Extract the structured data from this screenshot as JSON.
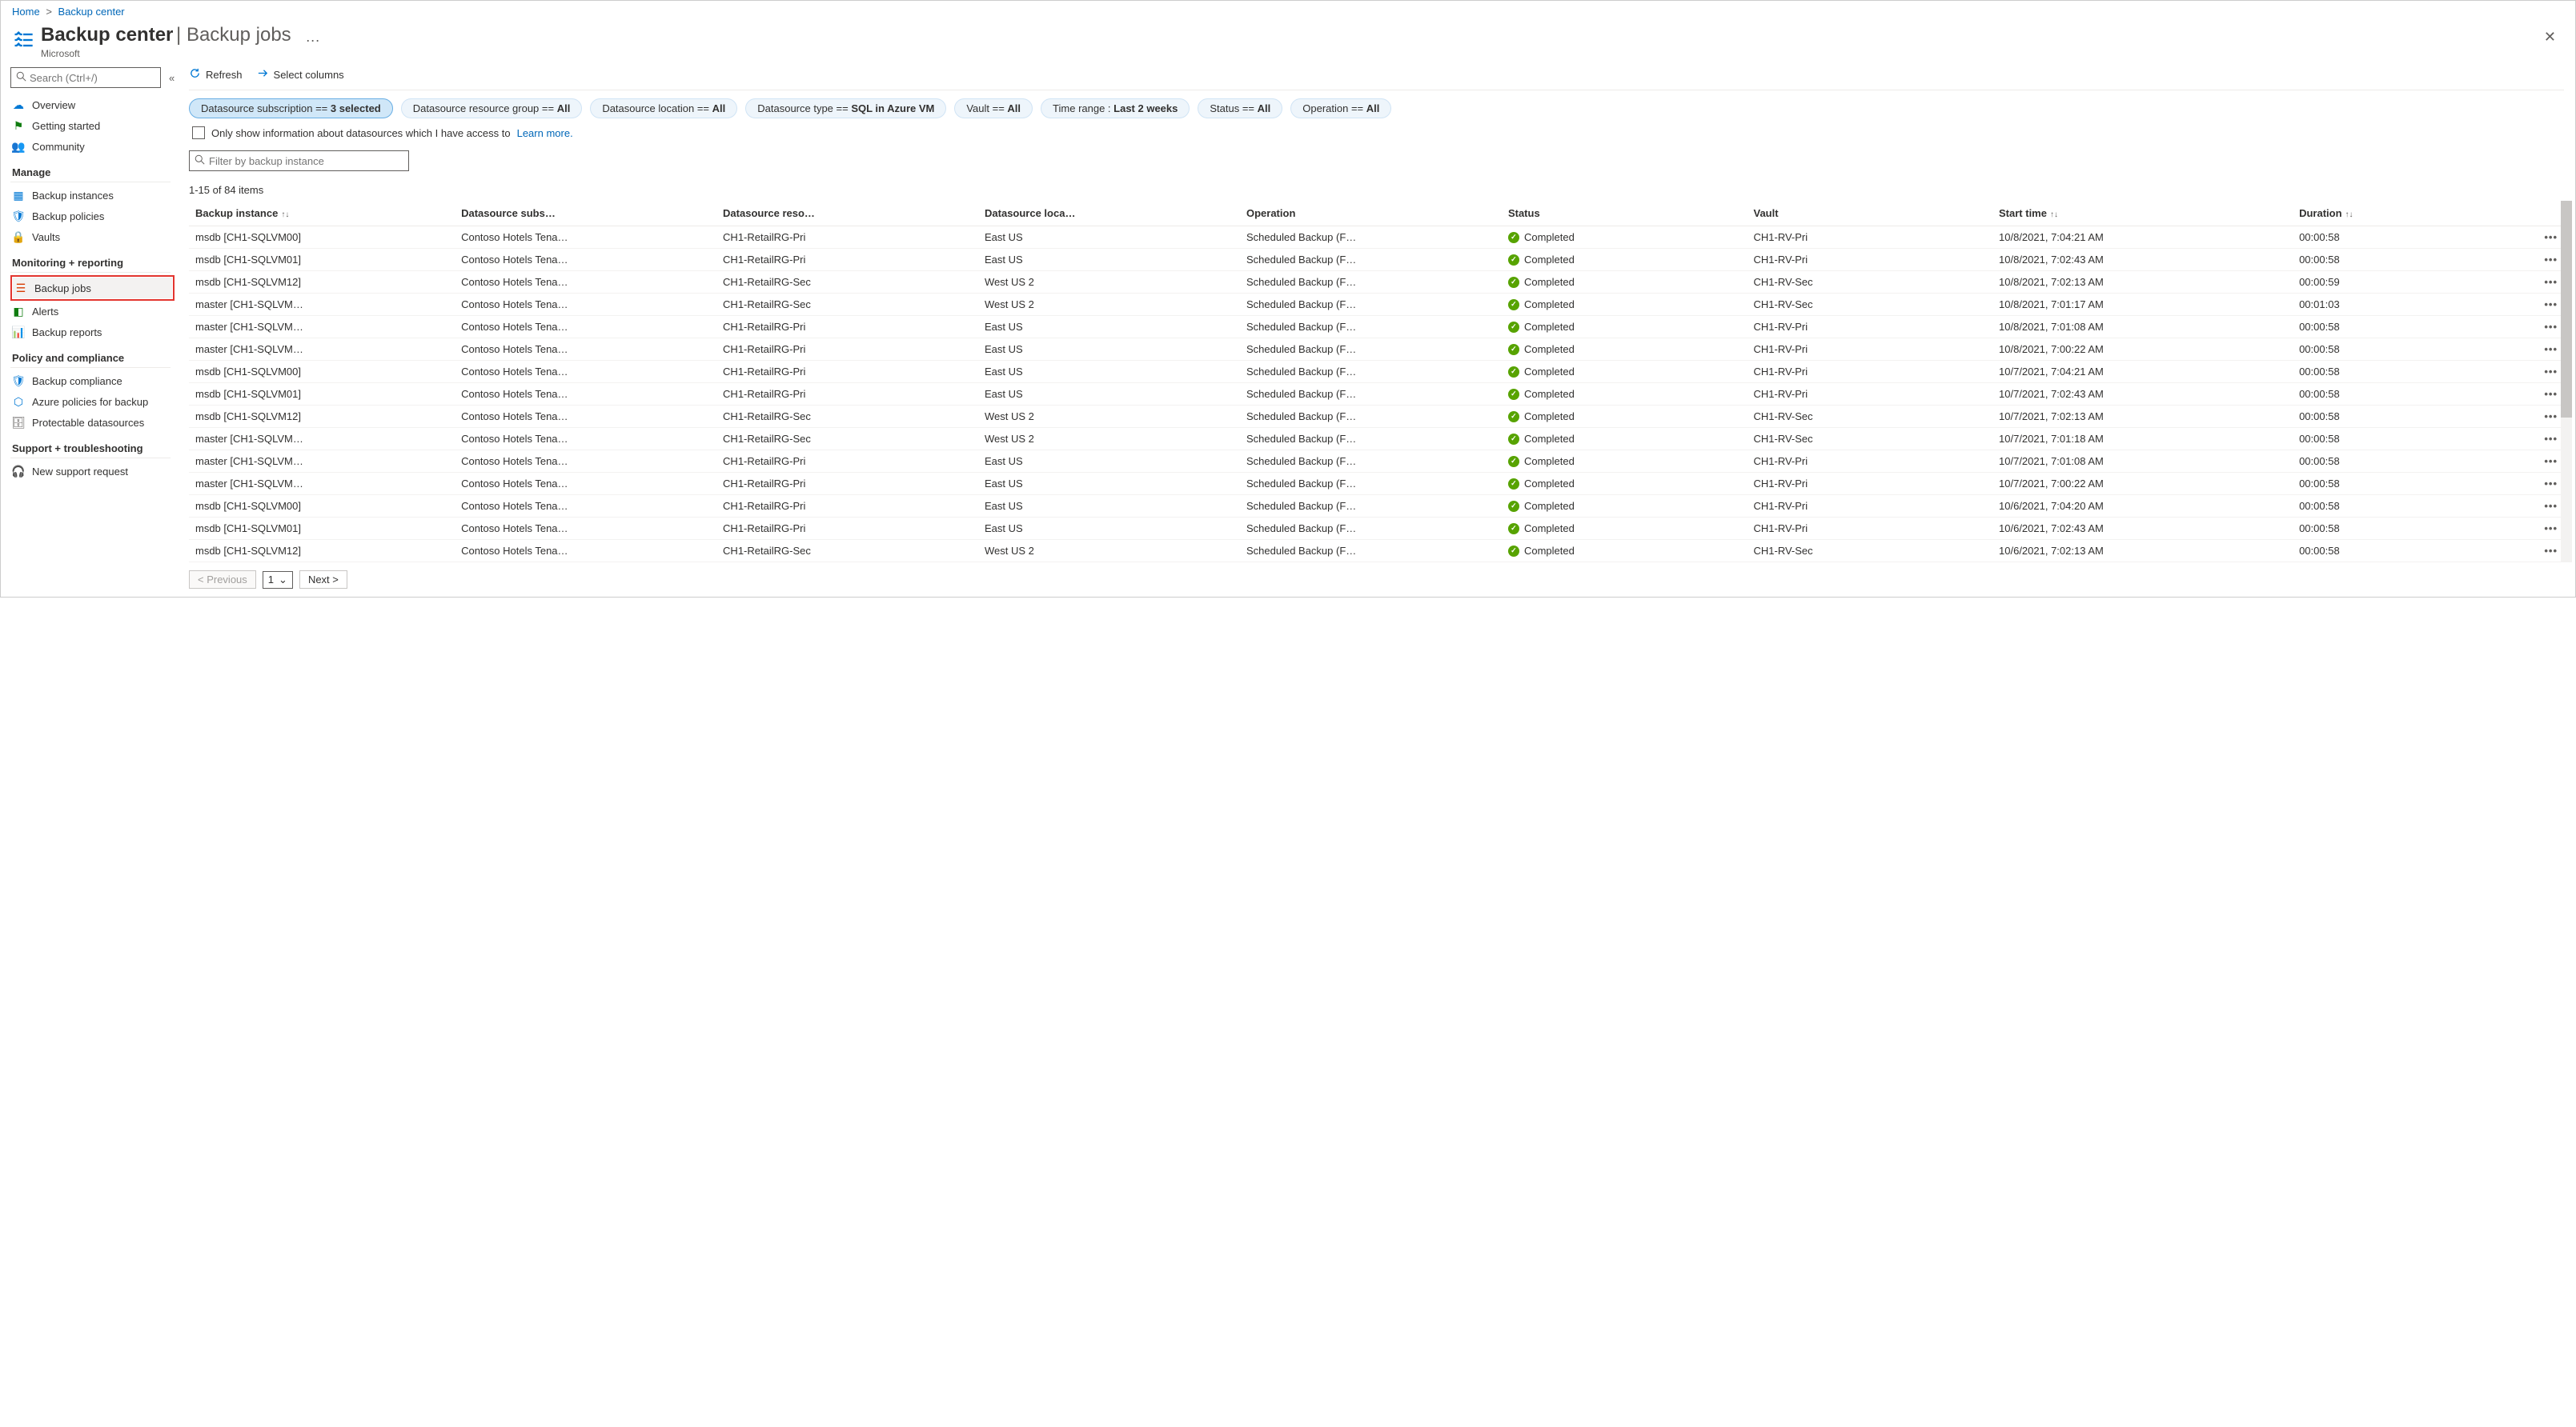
{
  "breadcrumb": {
    "home": "Home",
    "current": "Backup center"
  },
  "header": {
    "title": "Backup center",
    "subtitle": "Backup jobs",
    "org": "Microsoft",
    "dots": "···"
  },
  "sidebar": {
    "search_placeholder": "Search (Ctrl+/)",
    "items_top": [
      {
        "label": "Overview"
      },
      {
        "label": "Getting started"
      },
      {
        "label": "Community"
      }
    ],
    "group_manage": "Manage",
    "items_manage": [
      {
        "label": "Backup instances"
      },
      {
        "label": "Backup policies"
      },
      {
        "label": "Vaults"
      }
    ],
    "group_monitor": "Monitoring + reporting",
    "items_monitor": [
      {
        "label": "Backup jobs",
        "selected": true
      },
      {
        "label": "Alerts"
      },
      {
        "label": "Backup reports"
      }
    ],
    "group_policy": "Policy and compliance",
    "items_policy": [
      {
        "label": "Backup compliance"
      },
      {
        "label": "Azure policies for backup"
      },
      {
        "label": "Protectable datasources"
      }
    ],
    "group_support": "Support + troubleshooting",
    "items_support": [
      {
        "label": "New support request"
      }
    ]
  },
  "toolbar": {
    "refresh": "Refresh",
    "select_columns": "Select columns"
  },
  "filters": {
    "subscription": {
      "prefix": "Datasource subscription == ",
      "value": "3 selected"
    },
    "rg": {
      "prefix": "Datasource resource group == ",
      "value": "All"
    },
    "location": {
      "prefix": "Datasource location == ",
      "value": "All"
    },
    "type": {
      "prefix": "Datasource type == ",
      "value": "SQL in Azure VM"
    },
    "vault": {
      "prefix": "Vault == ",
      "value": "All"
    },
    "time": {
      "prefix": "Time range : ",
      "value": "Last 2 weeks"
    },
    "status": {
      "prefix": "Status == ",
      "value": "All"
    },
    "operation": {
      "prefix": "Operation == ",
      "value": "All"
    }
  },
  "access_row": {
    "text": "Only show information about datasources which I have access to",
    "link": "Learn more."
  },
  "filter_input_placeholder": "Filter by backup instance",
  "count_text": "1-15 of 84 items",
  "columns": {
    "instance": "Backup instance",
    "subs": "Datasource subs…",
    "rg": "Datasource reso…",
    "loc": "Datasource loca…",
    "op": "Operation",
    "status": "Status",
    "vault": "Vault",
    "start": "Start time",
    "dur": "Duration"
  },
  "rows": [
    {
      "instance": "msdb [CH1-SQLVM00]",
      "subs": "Contoso Hotels Tena…",
      "rg": "CH1-RetailRG-Pri",
      "loc": "East US",
      "op": "Scheduled Backup (F…",
      "status": "Completed",
      "vault": "CH1-RV-Pri",
      "start": "10/8/2021, 7:04:21 AM",
      "dur": "00:00:58"
    },
    {
      "instance": "msdb [CH1-SQLVM01]",
      "subs": "Contoso Hotels Tena…",
      "rg": "CH1-RetailRG-Pri",
      "loc": "East US",
      "op": "Scheduled Backup (F…",
      "status": "Completed",
      "vault": "CH1-RV-Pri",
      "start": "10/8/2021, 7:02:43 AM",
      "dur": "00:00:58"
    },
    {
      "instance": "msdb [CH1-SQLVM12]",
      "subs": "Contoso Hotels Tena…",
      "rg": "CH1-RetailRG-Sec",
      "loc": "West US 2",
      "op": "Scheduled Backup (F…",
      "status": "Completed",
      "vault": "CH1-RV-Sec",
      "start": "10/8/2021, 7:02:13 AM",
      "dur": "00:00:59"
    },
    {
      "instance": "master [CH1-SQLVM…",
      "subs": "Contoso Hotels Tena…",
      "rg": "CH1-RetailRG-Sec",
      "loc": "West US 2",
      "op": "Scheduled Backup (F…",
      "status": "Completed",
      "vault": "CH1-RV-Sec",
      "start": "10/8/2021, 7:01:17 AM",
      "dur": "00:01:03"
    },
    {
      "instance": "master [CH1-SQLVM…",
      "subs": "Contoso Hotels Tena…",
      "rg": "CH1-RetailRG-Pri",
      "loc": "East US",
      "op": "Scheduled Backup (F…",
      "status": "Completed",
      "vault": "CH1-RV-Pri",
      "start": "10/8/2021, 7:01:08 AM",
      "dur": "00:00:58"
    },
    {
      "instance": "master [CH1-SQLVM…",
      "subs": "Contoso Hotels Tena…",
      "rg": "CH1-RetailRG-Pri",
      "loc": "East US",
      "op": "Scheduled Backup (F…",
      "status": "Completed",
      "vault": "CH1-RV-Pri",
      "start": "10/8/2021, 7:00:22 AM",
      "dur": "00:00:58"
    },
    {
      "instance": "msdb [CH1-SQLVM00]",
      "subs": "Contoso Hotels Tena…",
      "rg": "CH1-RetailRG-Pri",
      "loc": "East US",
      "op": "Scheduled Backup (F…",
      "status": "Completed",
      "vault": "CH1-RV-Pri",
      "start": "10/7/2021, 7:04:21 AM",
      "dur": "00:00:58"
    },
    {
      "instance": "msdb [CH1-SQLVM01]",
      "subs": "Contoso Hotels Tena…",
      "rg": "CH1-RetailRG-Pri",
      "loc": "East US",
      "op": "Scheduled Backup (F…",
      "status": "Completed",
      "vault": "CH1-RV-Pri",
      "start": "10/7/2021, 7:02:43 AM",
      "dur": "00:00:58"
    },
    {
      "instance": "msdb [CH1-SQLVM12]",
      "subs": "Contoso Hotels Tena…",
      "rg": "CH1-RetailRG-Sec",
      "loc": "West US 2",
      "op": "Scheduled Backup (F…",
      "status": "Completed",
      "vault": "CH1-RV-Sec",
      "start": "10/7/2021, 7:02:13 AM",
      "dur": "00:00:58"
    },
    {
      "instance": "master [CH1-SQLVM…",
      "subs": "Contoso Hotels Tena…",
      "rg": "CH1-RetailRG-Sec",
      "loc": "West US 2",
      "op": "Scheduled Backup (F…",
      "status": "Completed",
      "vault": "CH1-RV-Sec",
      "start": "10/7/2021, 7:01:18 AM",
      "dur": "00:00:58"
    },
    {
      "instance": "master [CH1-SQLVM…",
      "subs": "Contoso Hotels Tena…",
      "rg": "CH1-RetailRG-Pri",
      "loc": "East US",
      "op": "Scheduled Backup (F…",
      "status": "Completed",
      "vault": "CH1-RV-Pri",
      "start": "10/7/2021, 7:01:08 AM",
      "dur": "00:00:58"
    },
    {
      "instance": "master [CH1-SQLVM…",
      "subs": "Contoso Hotels Tena…",
      "rg": "CH1-RetailRG-Pri",
      "loc": "East US",
      "op": "Scheduled Backup (F…",
      "status": "Completed",
      "vault": "CH1-RV-Pri",
      "start": "10/7/2021, 7:00:22 AM",
      "dur": "00:00:58"
    },
    {
      "instance": "msdb [CH1-SQLVM00]",
      "subs": "Contoso Hotels Tena…",
      "rg": "CH1-RetailRG-Pri",
      "loc": "East US",
      "op": "Scheduled Backup (F…",
      "status": "Completed",
      "vault": "CH1-RV-Pri",
      "start": "10/6/2021, 7:04:20 AM",
      "dur": "00:00:58"
    },
    {
      "instance": "msdb [CH1-SQLVM01]",
      "subs": "Contoso Hotels Tena…",
      "rg": "CH1-RetailRG-Pri",
      "loc": "East US",
      "op": "Scheduled Backup (F…",
      "status": "Completed",
      "vault": "CH1-RV-Pri",
      "start": "10/6/2021, 7:02:43 AM",
      "dur": "00:00:58"
    },
    {
      "instance": "msdb [CH1-SQLVM12]",
      "subs": "Contoso Hotels Tena…",
      "rg": "CH1-RetailRG-Sec",
      "loc": "West US 2",
      "op": "Scheduled Backup (F…",
      "status": "Completed",
      "vault": "CH1-RV-Sec",
      "start": "10/6/2021, 7:02:13 AM",
      "dur": "00:00:58"
    }
  ],
  "pager": {
    "prev": "< Previous",
    "page": "1",
    "next": "Next >"
  },
  "icons": {
    "overview": "#0078d4",
    "getting": "#107c10",
    "community": "#0078d4",
    "instances": "#0078d4",
    "policies": "#0078d4",
    "vaults": "#0078d4",
    "jobs": "#d83b01",
    "alerts": "#107c10",
    "reports": "#0078d4",
    "compliance": "#0078d4",
    "azpolicy": "#0078d4",
    "protect": "#605e5c",
    "support": "#323130"
  }
}
